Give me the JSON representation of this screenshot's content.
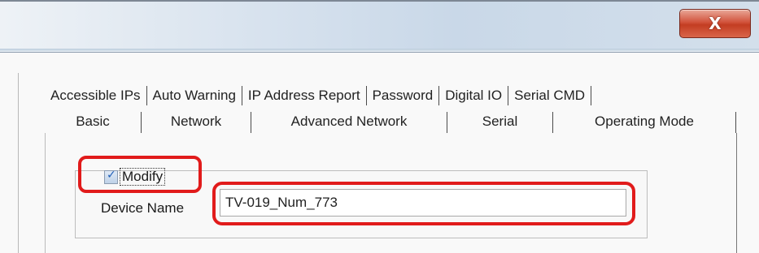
{
  "window": {
    "close_symbol": "X"
  },
  "tabs_row1": [
    "Accessible IPs",
    "Auto Warning",
    "IP Address Report",
    "Password",
    "Digital IO",
    "Serial CMD"
  ],
  "tabs_row2": [
    "Basic",
    "Network",
    "Advanced Network",
    "Serial",
    "Operating Mode"
  ],
  "basic": {
    "modify_label": "Modify",
    "modify_checked": true,
    "device_name_label": "Device Name",
    "device_name_value": "TV-019_Num_773"
  },
  "colors": {
    "highlight": "#e11b1b",
    "close_button": "#c33d22"
  }
}
